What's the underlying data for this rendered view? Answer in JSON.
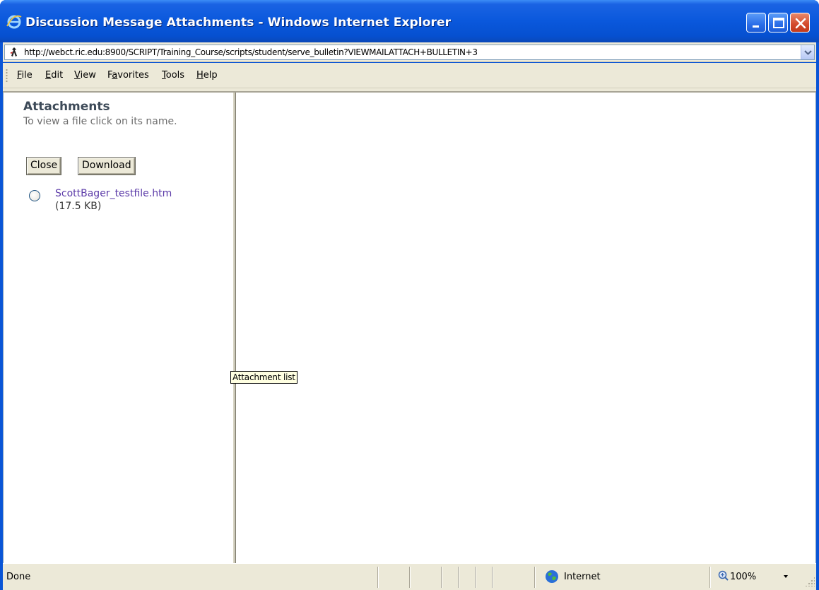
{
  "window": {
    "title": "Discussion Message Attachments - Windows Internet Explorer",
    "accent_color": "#0a55d6",
    "icon": "ie-logo-icon"
  },
  "address_bar": {
    "url": "http://webct.ric.edu:8900/SCRIPT/Training_Course/scripts/student/serve_bulletin?VIEWMAILATTACH+BULLETIN+3",
    "icon": "webct-page-icon"
  },
  "menu": {
    "items": [
      {
        "label_u": "F",
        "label_rest": "ile"
      },
      {
        "label_u": "E",
        "label_rest": "dit"
      },
      {
        "label_u": "V",
        "label_rest": "iew"
      },
      {
        "label_pre": "F",
        "label_u": "a",
        "label_rest": "vorites"
      },
      {
        "label_u": "T",
        "label_rest": "ools"
      },
      {
        "label_u": "H",
        "label_rest": "elp"
      }
    ]
  },
  "attachments": {
    "title": "Attachments",
    "help_text": "To view a file click on its name.",
    "close_label": "Close",
    "download_label": "Download",
    "files": [
      {
        "name": "ScottBager_testfile.htm",
        "size": "(17.5 KB)",
        "selected": false
      }
    ]
  },
  "tooltip": "Attachment list",
  "status": {
    "text": "Done",
    "zone": "Internet",
    "zoom": "100%"
  }
}
